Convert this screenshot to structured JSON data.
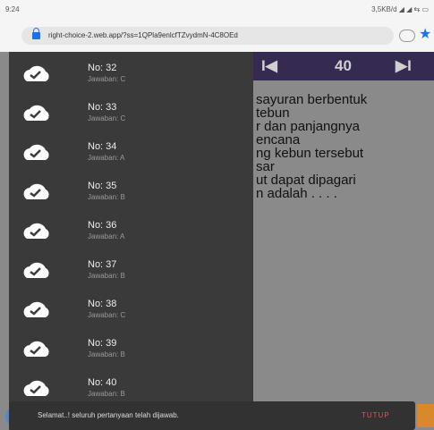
{
  "status_bar": {
    "time": "9:24",
    "right_info": "3,5KB/d ◢ ◢ ⇆ ▭"
  },
  "browser": {
    "url": "right-choice-2.web.app/?ss=1QPla9enlcfTZvydmN-4C8OEd",
    "star_icon": "★"
  },
  "nav": {
    "prev": "I◀",
    "number": "40",
    "next": "▶I"
  },
  "question_lines": [
    "sayuran berbentuk",
    "tebun",
    "r dan panjangnya",
    "encana",
    "ng kebun tersebut",
    "sar",
    "ut dapat dipagari",
    "n adalah . . . ."
  ],
  "answer_list": [
    {
      "no": "No: 32",
      "answer": "Jawaban: C"
    },
    {
      "no": "No: 33",
      "answer": "Jawaban: C"
    },
    {
      "no": "No: 34",
      "answer": "Jawaban: A"
    },
    {
      "no": "No: 35",
      "answer": "Jawaban: B"
    },
    {
      "no": "No: 36",
      "answer": "Jawaban: A"
    },
    {
      "no": "No: 37",
      "answer": "Jawaban: B"
    },
    {
      "no": "No: 38",
      "answer": "Jawaban: C"
    },
    {
      "no": "No: 39",
      "answer": "Jawaban: B"
    },
    {
      "no": "No: 40",
      "answer": "Jawaban: B"
    }
  ],
  "snackbar": {
    "message": "Selamat..! seluruh pertanyaan telah dijawab.",
    "action": "TUTUP"
  },
  "colors": {
    "drawer": "#3a3a3a",
    "nav": "#342a52",
    "action": "#f24c5c",
    "icon": "#ffffff"
  }
}
